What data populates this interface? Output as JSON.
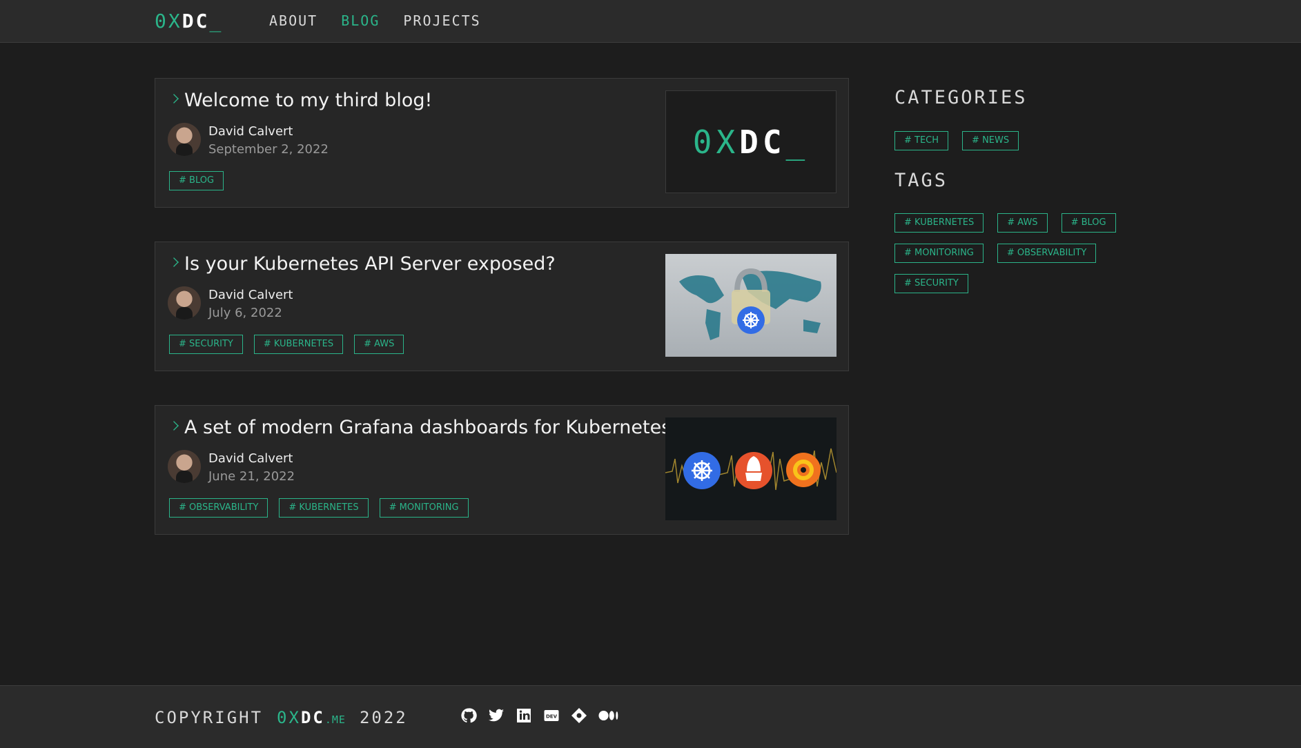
{
  "header": {
    "logo": {
      "hex": "0X",
      "dc": "DC",
      "cursor": "_"
    },
    "nav": [
      {
        "label": "ABOUT",
        "active": false
      },
      {
        "label": "BLOG",
        "active": true
      },
      {
        "label": "PROJECTS",
        "active": false
      }
    ]
  },
  "posts": [
    {
      "title": "Welcome to my third blog!",
      "author": "David Calvert",
      "date": "September 2, 2022",
      "tags": [
        "# BLOG"
      ]
    },
    {
      "title": "Is your Kubernetes API Server exposed?",
      "author": "David Calvert",
      "date": "July 6, 2022",
      "tags": [
        "# SECURITY",
        "# KUBERNETES",
        "# AWS"
      ]
    },
    {
      "title": "A set of modern Grafana dashboards for Kubernetes",
      "author": "David Calvert",
      "date": "June 21, 2022",
      "tags": [
        "# OBSERVABILITY",
        "# KUBERNETES",
        "# MONITORING"
      ]
    }
  ],
  "sidebar": {
    "categories_title": "CATEGORIES",
    "categories": [
      "# TECH",
      "# NEWS"
    ],
    "tags_title": "TAGS",
    "tags": [
      "# KUBERNETES",
      "# AWS",
      "# BLOG",
      "# MONITORING",
      "# OBSERVABILITY",
      "# SECURITY"
    ]
  },
  "footer": {
    "copyright": "COPYRIGHT",
    "brand_hex": "0X",
    "brand_dc": "DC",
    "brand_me": ".ME",
    "year": "2022",
    "socials": [
      "github-icon",
      "twitter-icon",
      "linkedin-icon",
      "dev-icon",
      "codeberg-icon",
      "medium-icon"
    ]
  },
  "colors": {
    "accent": "#2bb58a",
    "background": "#1d1d1d",
    "panel": "#262626",
    "bar": "#2b2b2b"
  }
}
